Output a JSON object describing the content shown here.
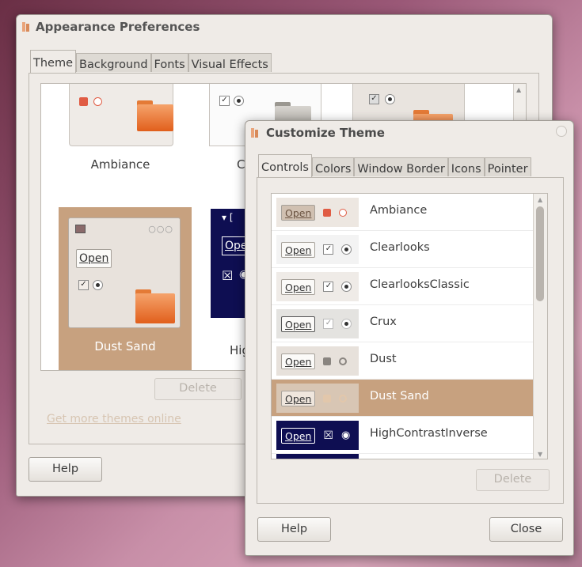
{
  "appearance": {
    "title": "Appearance Preferences",
    "tabs": [
      "Theme",
      "Background",
      "Fonts",
      "Visual Effects"
    ],
    "themes": [
      {
        "name": "Ambiance"
      },
      {
        "name": "C"
      },
      {
        "name": "Dust Sand",
        "selected": true
      },
      {
        "name": "Hig"
      }
    ],
    "preview_open_label": "Open",
    "delete_label": "Delete",
    "more_link": "Get more themes online",
    "help_label": "Help"
  },
  "customize": {
    "title": "Customize Theme",
    "tabs": [
      "Controls",
      "Colors",
      "Window Border",
      "Icons",
      "Pointer"
    ],
    "open_label": "Open",
    "controls_list": [
      {
        "name": "Ambiance"
      },
      {
        "name": "Clearlooks"
      },
      {
        "name": "ClearlooksClassic"
      },
      {
        "name": "Crux"
      },
      {
        "name": "Dust"
      },
      {
        "name": "Dust Sand",
        "selected": true
      },
      {
        "name": "HighContrastInverse"
      }
    ],
    "delete_label": "Delete",
    "help_label": "Help",
    "close_label": "Close"
  },
  "colors": {
    "selection": "#c7a17f",
    "ubuntu_orange": "#e9672a",
    "high_contrast_bg": "#0e0e52"
  }
}
